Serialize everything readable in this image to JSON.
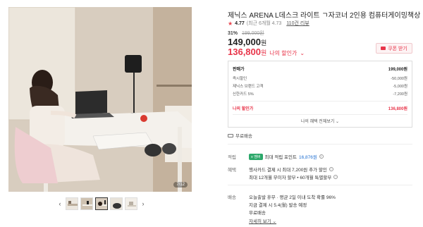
{
  "gallery": {
    "counter": "7/12",
    "prev_arrow": "‹",
    "next_arrow": "›",
    "thumbs": [
      "thumb-1",
      "thumb-2",
      "thumb-3",
      "thumb-4",
      "thumb-5"
    ],
    "active_thumb_index": 2
  },
  "product": {
    "title": "제닉스 ARENA L데스크 라이트 ㄱ자코너 2인용 컴퓨터게이밍책상",
    "rating": "4.77",
    "rating_note": "(최근 6개월 4.73",
    "review_link": "110건 리뷰",
    "discount_rate": "31%",
    "original_price": "199,000원",
    "price": "149,000",
    "price_unit": "원",
    "my_price": "136,800",
    "my_price_unit": "원",
    "my_price_label": "나의 할인가",
    "coupon_label": "쿠폰 받기"
  },
  "breakdown": {
    "rows": [
      {
        "label": "판매가",
        "value": "199,000원"
      },
      {
        "label": "즉시할인",
        "value": "-50,000원"
      },
      {
        "label": "제닉스 브랜드 고객",
        "value": "-5,000원"
      },
      {
        "label": "신한카드 5%",
        "value": "-7,200원"
      }
    ],
    "total_label": "나의 할인가",
    "total_value": "136,800원",
    "more_label": "나의 혜택 전체보기 ⌄"
  },
  "shipping_badge": "무료배송",
  "points": {
    "label": "적립",
    "badge": "≡ 멤버",
    "text": "최대 적립 포인트",
    "value": "16,876원"
  },
  "benefit": {
    "label": "혜택",
    "line1": "행사카드 결제 시 최대 7,200원 추가 할인",
    "line2": "최대 12개월 무이자 할부 • 60개월 특별할부"
  },
  "delivery": {
    "label": "배송",
    "line1": "오늘출발 휴무 · 평균 2일 이내 도착 확률 96%",
    "line2": "지금 결제 시 5.4(월) 발송 예정",
    "line3": "무료배송",
    "detail_link": "자세히 보기 ⌄"
  }
}
